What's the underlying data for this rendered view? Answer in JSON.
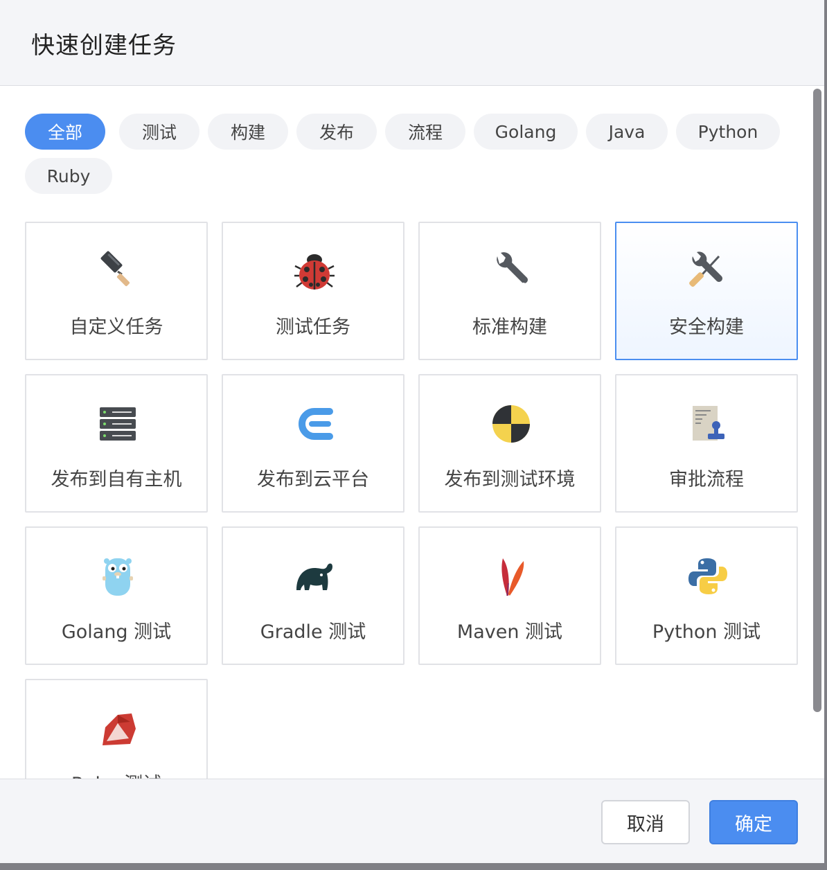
{
  "dialog": {
    "title": "快速创建任务"
  },
  "filters": [
    "全部",
    "测试",
    "构建",
    "发布",
    "流程",
    "Golang",
    "Java",
    "Python",
    "Ruby"
  ],
  "active_filter": "全部",
  "cards": [
    {
      "label": "自定义任务",
      "icon": "paint-roller-icon"
    },
    {
      "label": "测试任务",
      "icon": "ladybug-icon"
    },
    {
      "label": "标准构建",
      "icon": "wrench-icon"
    },
    {
      "label": "安全构建",
      "icon": "wrench-screwdriver-icon",
      "selected": true
    },
    {
      "label": "发布到自有主机",
      "icon": "server-icon"
    },
    {
      "label": "发布到云平台",
      "icon": "cloud-platform-icon"
    },
    {
      "label": "发布到测试环境",
      "icon": "crash-test-icon"
    },
    {
      "label": "审批流程",
      "icon": "approval-stamp-icon"
    },
    {
      "label": "Golang 测试",
      "icon": "gopher-icon"
    },
    {
      "label": "Gradle 测试",
      "icon": "gradle-elephant-icon"
    },
    {
      "label": "Maven 测试",
      "icon": "maven-feather-icon"
    },
    {
      "label": "Python 测试",
      "icon": "python-icon"
    },
    {
      "label": "Ruby 测试",
      "icon": "ruby-icon"
    }
  ],
  "footer": {
    "cancel_label": "取消",
    "ok_label": "确定"
  },
  "colors": {
    "accent": "#4b8df0",
    "selected_border": "#4a8ef0"
  }
}
